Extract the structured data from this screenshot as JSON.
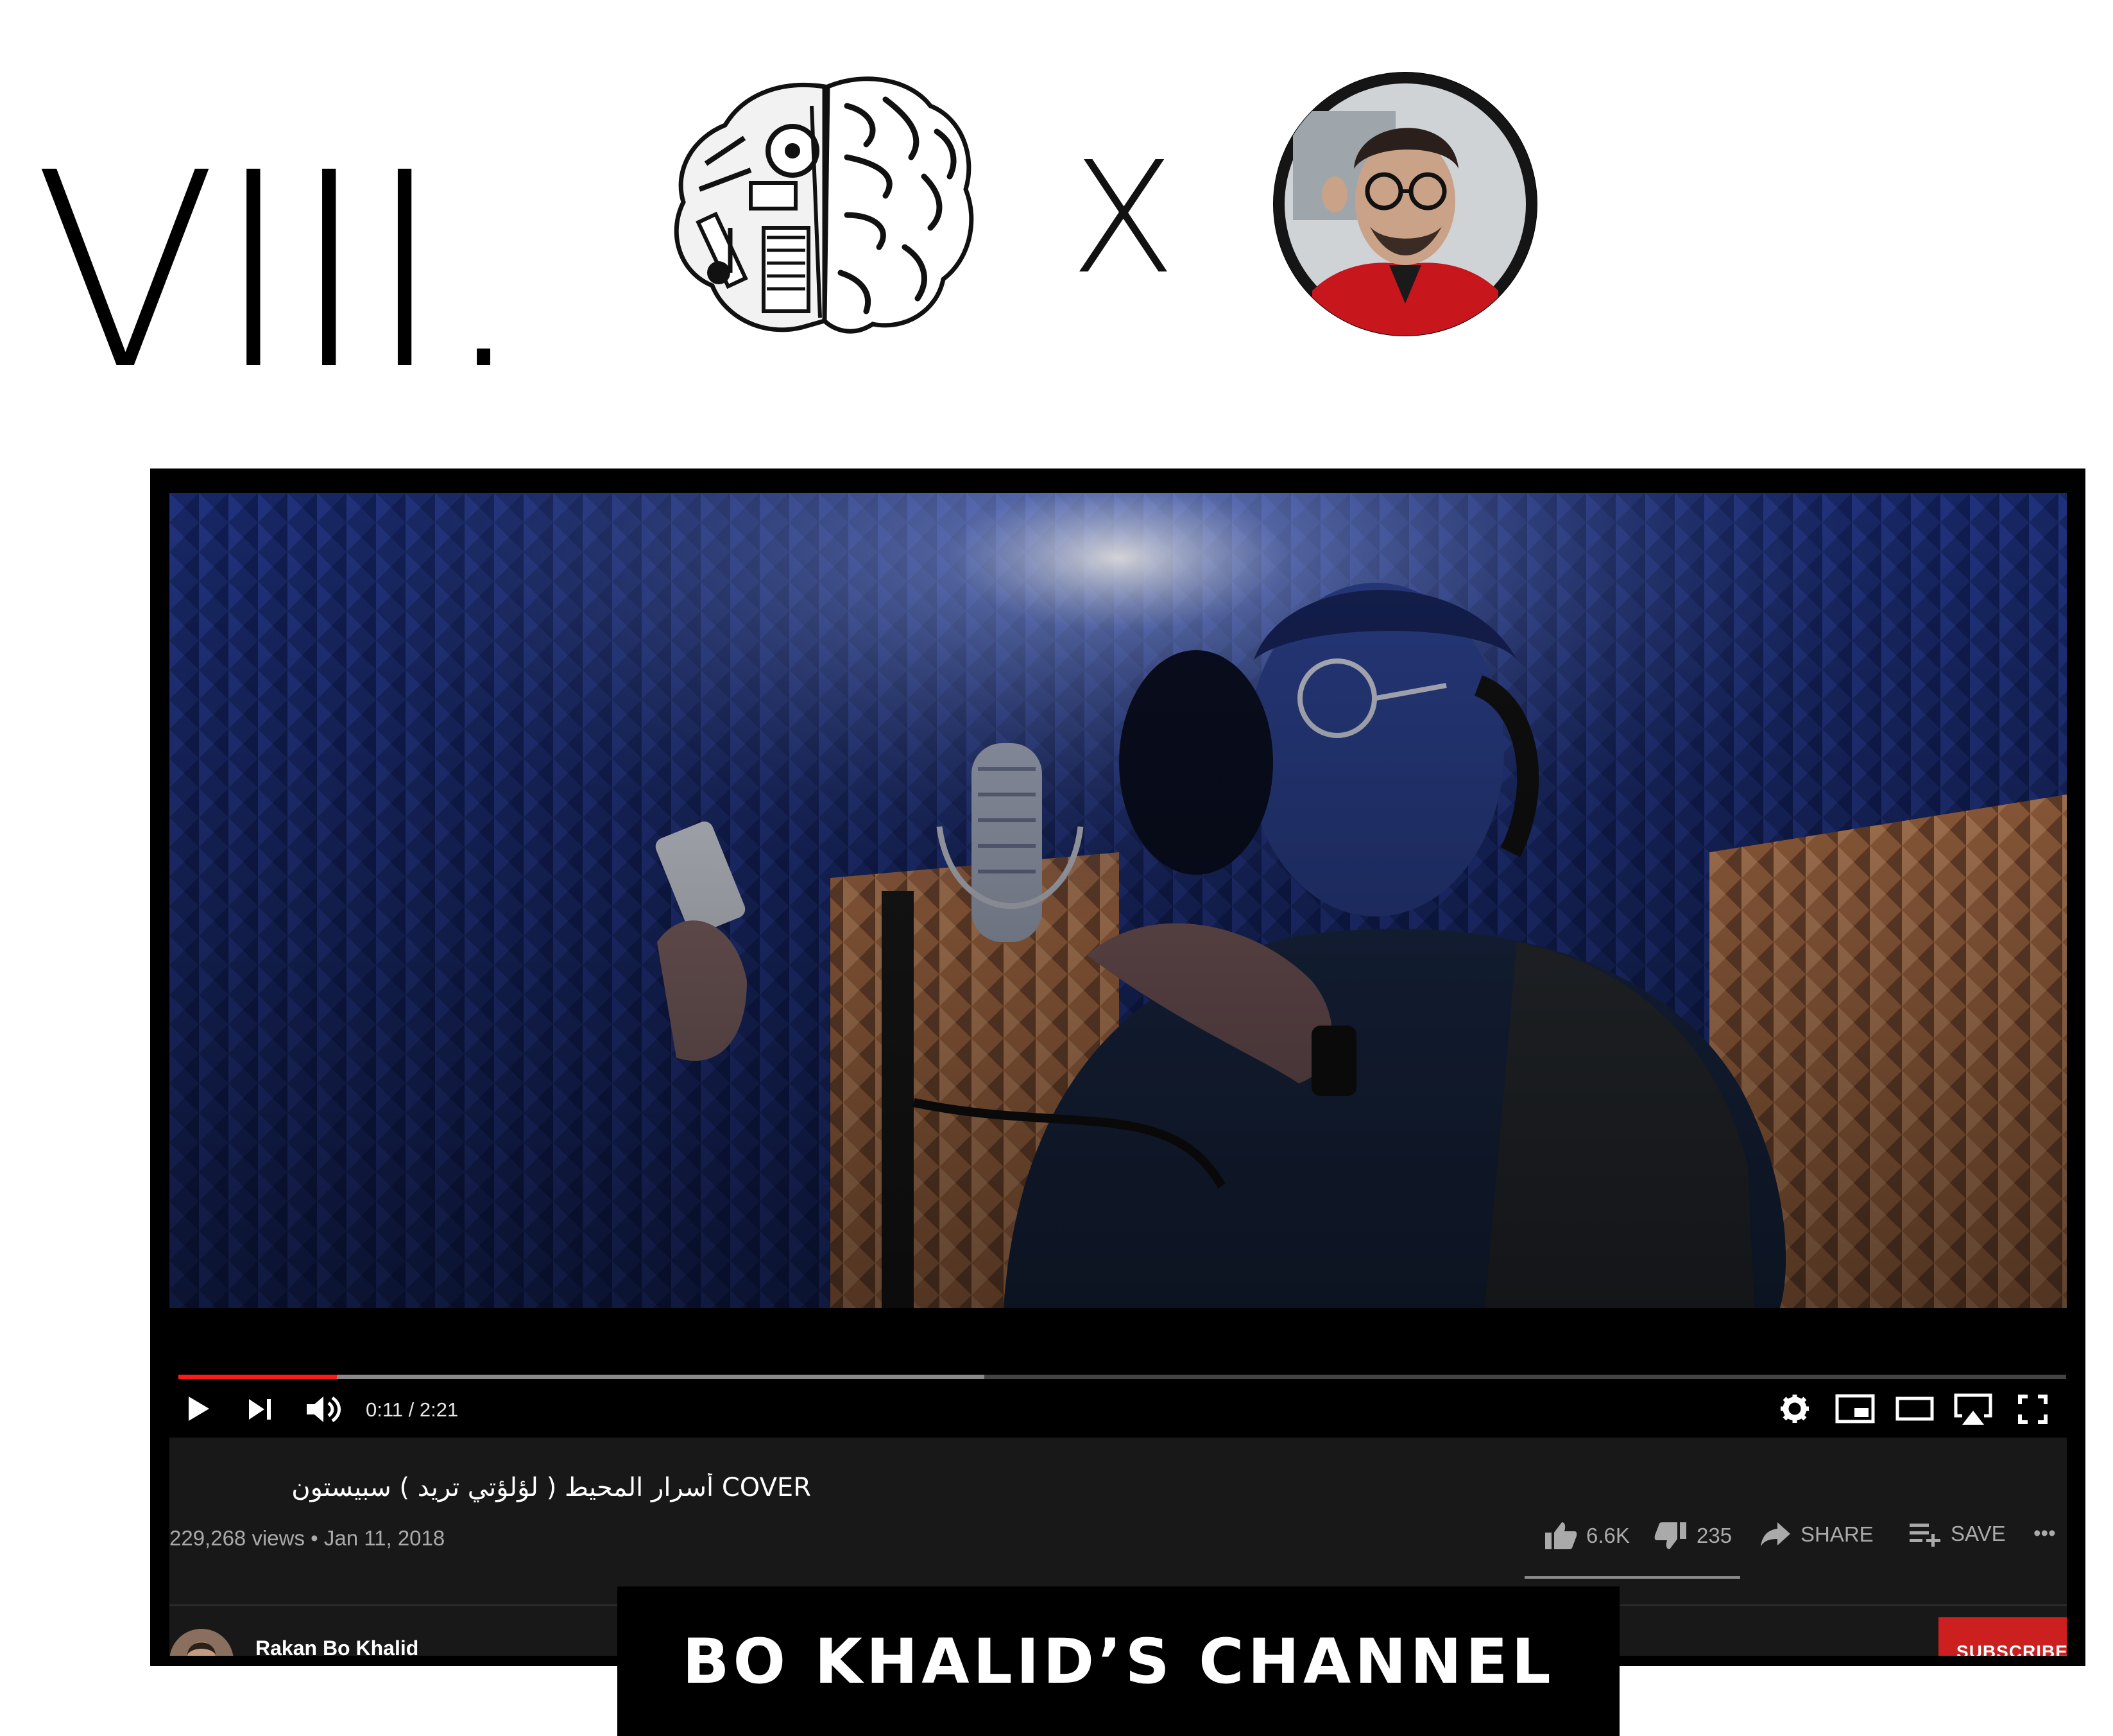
{
  "header": {
    "numeral": "VIII.",
    "connector": "X",
    "logo_icon": "brain-music-logo",
    "avatar_icon": "creator-avatar"
  },
  "player": {
    "time": "0:11 / 2:21",
    "progress_played": 0.084,
    "progress_buffered": 0.427,
    "title": "COVER أسرار المحيط ( لؤلؤتي تريد ) سبيستون",
    "meta": "229,268 views • Jan 11, 2018",
    "likes": "6.6K",
    "dislikes": "235",
    "share_label": "SHARE",
    "save_label": "SAVE",
    "more_label": "•••",
    "channel_name": "Rakan Bo Khalid",
    "subscribe_label": "SUBSCRIBE",
    "accent_color": "#ff1a1a"
  },
  "caption": {
    "text": "BO KHALID’S CHANNEL"
  }
}
